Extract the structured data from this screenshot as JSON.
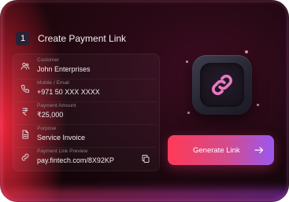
{
  "header": {
    "step": "1",
    "title": "Create Payment Link"
  },
  "form": {
    "customer": {
      "label": "Customer",
      "value": "John Enterprises",
      "icon": "users-icon"
    },
    "mobile": {
      "label": "Mobile / Email",
      "value": "+971 50 XXX XXXX",
      "icon": "phone-icon"
    },
    "amount": {
      "label": "Payment Amount",
      "value": "₹25,000",
      "icon": "rupee-icon"
    },
    "purpose": {
      "label": "Purpose",
      "value": "Service Invoice",
      "icon": "document-icon"
    },
    "preview": {
      "label": "Payment Link Preview",
      "value": "pay.fintech.com/8X92KP",
      "icon": "link-icon"
    }
  },
  "action": {
    "label": "Generate Link",
    "arrow": "→"
  },
  "colors": {
    "accent_start": "#ff3a56",
    "accent_end": "#9a58f0",
    "link_icon": "#e879c0"
  }
}
